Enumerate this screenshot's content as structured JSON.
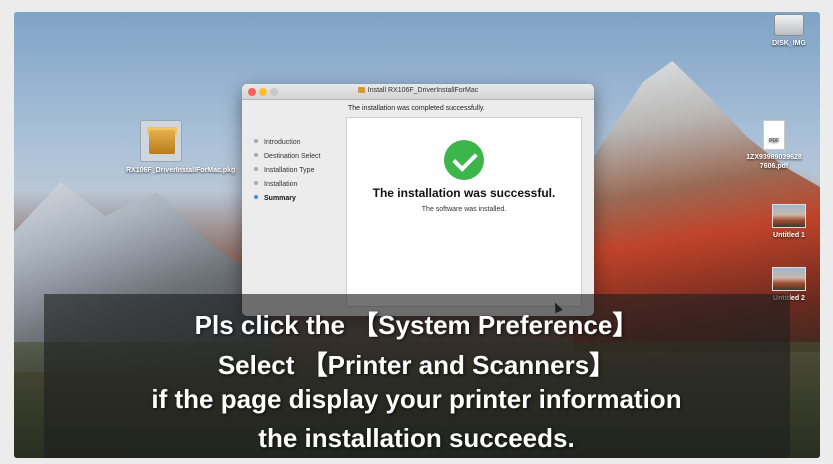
{
  "desktop": {
    "pkg_file": "RX106F_DriverInstallForMac.pkg",
    "disk": "DISK_IMG",
    "pdf_label": "PDF",
    "pdf_file": "1ZX93989039628 7606.pdf",
    "untitled1": "Untitled 1",
    "untitled2": "Untitled 2"
  },
  "installer": {
    "title": "Install RX106F_DriverInstallForMac",
    "subheading": "The installation was completed successfully.",
    "steps": [
      "Introduction",
      "Destination Select",
      "Installation Type",
      "Installation",
      "Summary"
    ],
    "active_step": "Summary",
    "success_heading": "The installation was successful.",
    "success_detail": "The software was installed."
  },
  "caption": {
    "line1": "Pls click the 【System Preference】",
    "line2": "Select 【Printer and Scanners】",
    "line3": "if the page display your printer information",
    "line4": "the installation succeeds."
  }
}
